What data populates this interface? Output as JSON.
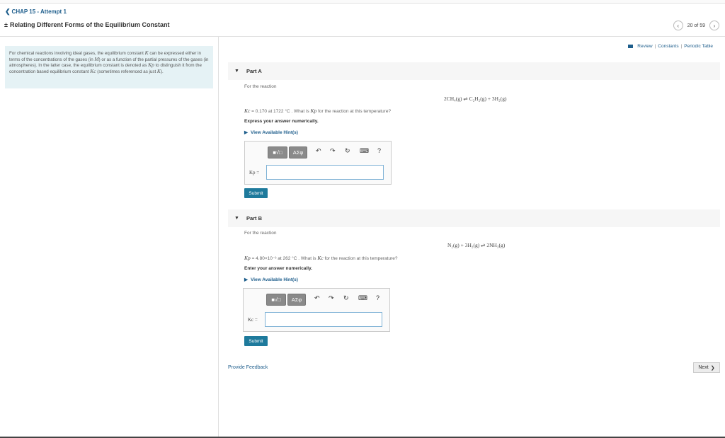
{
  "nav": {
    "back_label": "CHAP 15 - Attempt 1"
  },
  "header": {
    "title_prefix": "±",
    "title": "Relating Different Forms of the Equilibrium Constant",
    "pager": "20 of 59"
  },
  "intro": {
    "p1": "For chemical reactions involving ideal gases, the equilibrium constant",
    "K": "K",
    "p2": "can be expressed either in terms of the concentrations of the gases (in",
    "M": "M",
    "p3": ") or as a function of the partial pressures of the gases (in atmospheres). In the latter case, the equilibrium constant is denoted as",
    "Kp": "Kp",
    "p4": "to distinguish it from the concentration based equilibrium constant",
    "Kc": "Kc",
    "p5": "(sometimes referenced as just",
    "K2": "K",
    "p6": ")."
  },
  "review": {
    "review": "Review",
    "constants": "Constants",
    "periodic": "Periodic Table",
    "sep": "|"
  },
  "partA": {
    "header": "Part A",
    "for_reaction": "For the reaction",
    "equation": "2CH₄(g) ⇌ C₂H₂(g) + 3H₂(g)",
    "given_k": "Kc",
    "given_rest": " = 0.170 at 1722 °C . What is",
    "given_k2": "Kp",
    "given_end": " for the reaction at this temperature?",
    "instruction": "Express your answer numerically.",
    "hint": "View Available Hint(s)",
    "answer_label": "Kp =",
    "submit": "Submit"
  },
  "partB": {
    "header": "Part B",
    "for_reaction": "For the reaction",
    "equation": "N₂(g) + 3H₂(g) ⇌ 2NH₃(g)",
    "given_k": "Kp",
    "given_rest": " = 4.80×10⁻³ at 262 °C . What is",
    "given_k2": "Kc",
    "given_end": " for the reaction at this temperature?",
    "instruction": "Enter your answer numerically.",
    "hint": "View Available Hint(s)",
    "answer_label": "Kc =",
    "submit": "Submit"
  },
  "toolbar": {
    "templates": "■√□",
    "symbols": "AΣφ",
    "undo": "↶",
    "redo": "↷",
    "reset": "↻",
    "keyboard": "⌨",
    "help": "?"
  },
  "footer": {
    "feedback": "Provide Feedback",
    "next": "Next",
    "next_chev": "❯"
  }
}
